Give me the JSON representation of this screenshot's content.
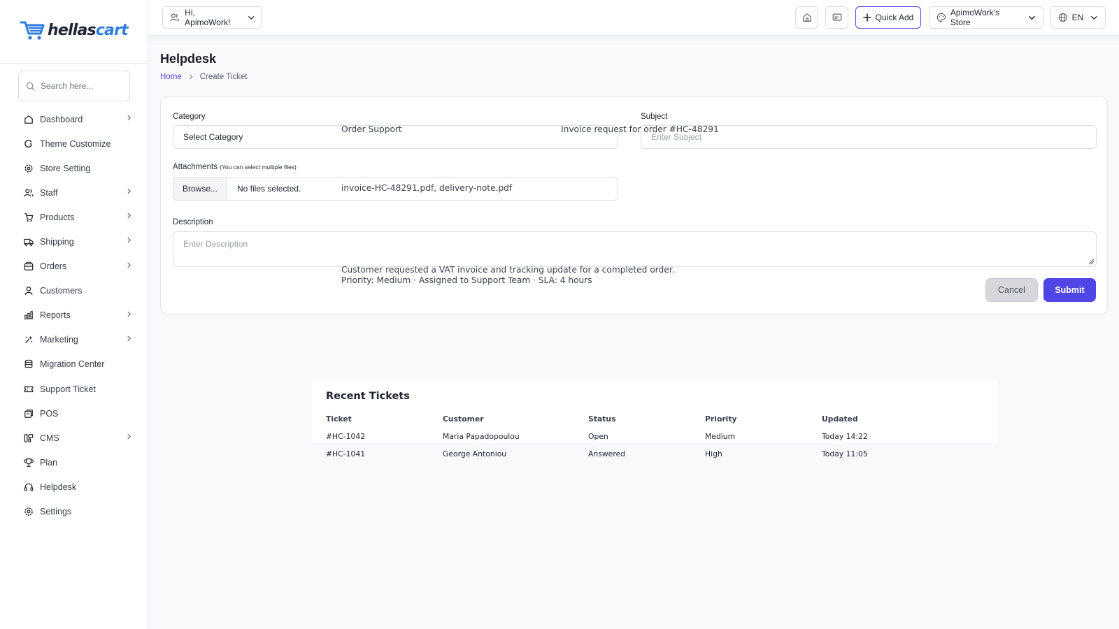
{
  "brand": {
    "part1": "hellas",
    "part2": "cart"
  },
  "sidebar": {
    "search_placeholder": "Search here...",
    "items": [
      {
        "label": "Dashboard",
        "icon": "home-icon",
        "chevron": true
      },
      {
        "label": "Theme Customize",
        "icon": "palette-icon",
        "chevron": false
      },
      {
        "label": "Store Setting",
        "icon": "gear-icon",
        "chevron": false
      },
      {
        "label": "Staff",
        "icon": "users-icon",
        "chevron": true
      },
      {
        "label": "Products",
        "icon": "cart-icon",
        "chevron": true
      },
      {
        "label": "Shipping",
        "icon": "truck-icon",
        "chevron": true
      },
      {
        "label": "Orders",
        "icon": "box-icon",
        "chevron": true
      },
      {
        "label": "Customers",
        "icon": "user-icon",
        "chevron": false
      },
      {
        "label": "Reports",
        "icon": "chart-icon",
        "chevron": true
      },
      {
        "label": "Marketing",
        "icon": "sparkle-icon",
        "chevron": true
      },
      {
        "label": "Migration Center",
        "icon": "database-icon",
        "chevron": false
      },
      {
        "label": "Support Ticket",
        "icon": "ticket-icon",
        "chevron": false
      },
      {
        "label": "POS",
        "icon": "pos-icon",
        "chevron": false
      },
      {
        "label": "CMS",
        "icon": "layout-icon",
        "chevron": true
      },
      {
        "label": "Plan",
        "icon": "trophy-icon",
        "chevron": false
      },
      {
        "label": "Helpdesk",
        "icon": "headset-icon",
        "chevron": false
      },
      {
        "label": "Settings",
        "icon": "settings-icon",
        "chevron": false
      }
    ]
  },
  "header": {
    "greeting": "Hi, ApimoWork!",
    "quick_add": "Quick Add",
    "store": "ApimoWork's Store",
    "language": "EN"
  },
  "page": {
    "title": "Helpdesk",
    "breadcrumb": {
      "home": "Home",
      "current": "Create Ticket"
    }
  },
  "form": {
    "category_label": "Category",
    "category_value": "Select Category",
    "category_overlay": "Order Support",
    "subject_label": "Subject",
    "subject_placeholder": "Enter Subject",
    "subject_overlay": "Invoice request for order #HC-48291",
    "attachments_label": "Attachments",
    "attachments_hint": "(You can select multiple files)",
    "browse_label": "Browse...",
    "no_files": "No files selected.",
    "attachments_overlay": "invoice-HC-48291.pdf, delivery-note.pdf",
    "description_label": "Description",
    "description_placeholder": "Enter Description",
    "description_overlay_line1": "Customer requested a VAT invoice and tracking update for a completed order.",
    "description_overlay_line2": "Priority: Medium · Assigned to Support Team · SLA: 4 hours",
    "cancel_label": "Cancel",
    "submit_label": "Submit"
  },
  "recent": {
    "title": "Recent Tickets",
    "columns": [
      "Ticket",
      "Customer",
      "Status",
      "Priority",
      "Updated"
    ],
    "rows": [
      [
        "#HC-1042",
        "Maria Papadopoulou",
        "Open",
        "Medium",
        "Today 14:22"
      ],
      [
        "#HC-1041",
        "George Antoniou",
        "Answered",
        "High",
        "Today 11:05"
      ]
    ]
  },
  "colors": {
    "accent": "#4f46e5",
    "brand_blue": "#2f7de1",
    "brand_dark": "#1f2737"
  }
}
